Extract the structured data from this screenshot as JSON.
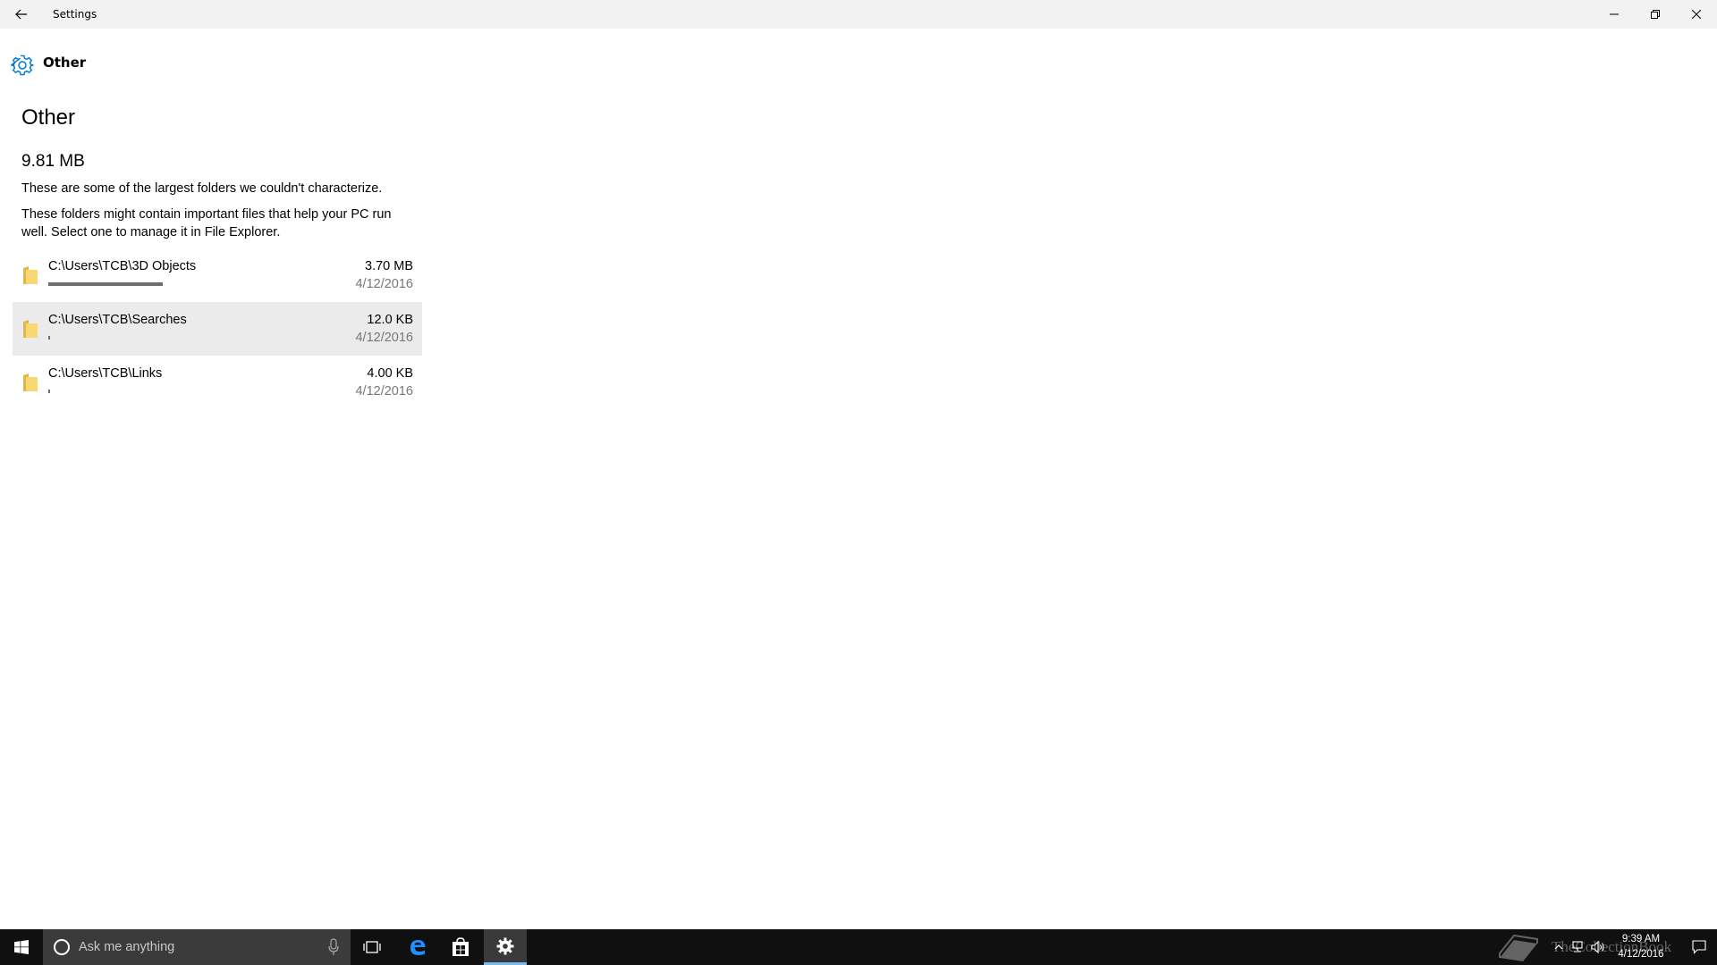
{
  "window": {
    "title": "Settings"
  },
  "header": {
    "icon": "gear-icon",
    "label": "Other"
  },
  "main": {
    "title": "Other",
    "total_size": "9.81 MB",
    "description_1": "These are some of the largest folders we couldn't characterize.",
    "description_2": "These folders might contain important files that help your PC run well. Select one to manage it in File Explorer."
  },
  "folders": [
    {
      "path": "C:\\Users\\TCB\\3D Objects",
      "size": "3.70 MB",
      "date": "4/12/2016",
      "usage_fraction": 0.51
    },
    {
      "path": "C:\\Users\\TCB\\Searches",
      "size": "12.0 KB",
      "date": "4/12/2016",
      "usage_fraction": 0.008
    },
    {
      "path": "C:\\Users\\TCB\\Links",
      "size": "4.00 KB",
      "date": "4/12/2016",
      "usage_fraction": 0.008
    }
  ],
  "taskbar": {
    "search_placeholder": "Ask me anything",
    "time": "9:39 AM",
    "date": "4/12/2016",
    "watermark": "TheCollectionBook"
  },
  "colors": {
    "accent": "#0078d7",
    "usage_bar": "#6e6e6e",
    "hover_row": "#ebebeb",
    "taskbar": "#101010"
  }
}
